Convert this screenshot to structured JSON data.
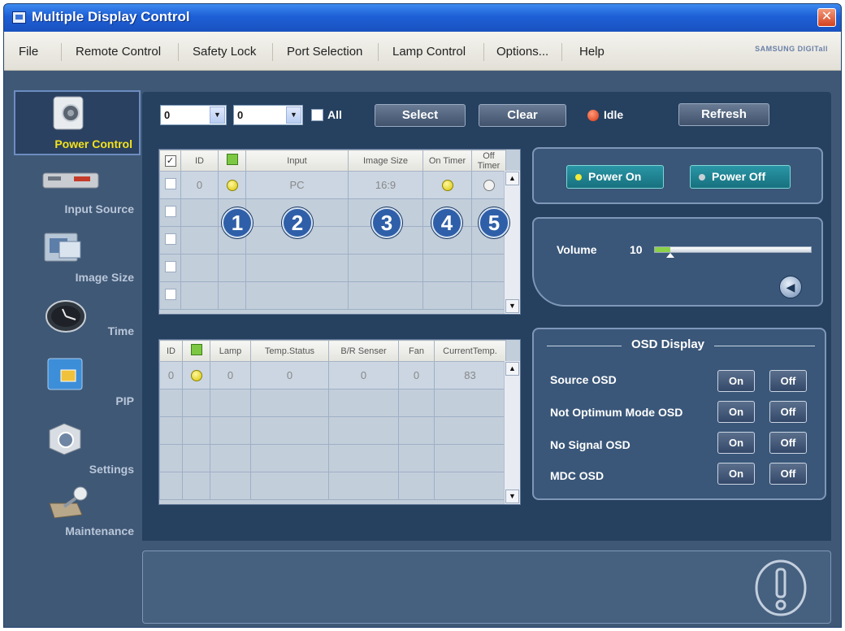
{
  "window": {
    "title": "Multiple Display Control",
    "close_glyph": "✕"
  },
  "menu": {
    "items": [
      "File",
      "Remote Control",
      "Safety Lock",
      "Port Selection",
      "Lamp Control",
      "Options...",
      "Help"
    ],
    "brand": "SAMSUNG DIGITall"
  },
  "nav": [
    {
      "label": "Power Control",
      "icon": "power-control-icon",
      "active": true
    },
    {
      "label": "Input Source",
      "icon": "input-source-icon"
    },
    {
      "label": "Image Size",
      "icon": "image-size-icon"
    },
    {
      "label": "Time",
      "icon": "clock-icon"
    },
    {
      "label": "PIP",
      "icon": "pip-icon"
    },
    {
      "label": "Settings",
      "icon": "settings-icon"
    },
    {
      "label": "Maintenance",
      "icon": "maintenance-icon"
    }
  ],
  "toolbar": {
    "select1_value": "0",
    "select2_value": "0",
    "all_label": "All",
    "select_label": "Select",
    "clear_label": "Clear",
    "status_label": "Idle",
    "refresh_label": "Refresh"
  },
  "top_grid": {
    "headers": [
      "ID",
      "Input",
      "Image Size",
      "On Timer",
      "Off Timer"
    ],
    "row": {
      "id": "0",
      "input": "PC",
      "image_size": "16:9"
    }
  },
  "callouts": [
    "1",
    "2",
    "3",
    "4",
    "5"
  ],
  "bottom_grid": {
    "headers": [
      "ID",
      "Lamp",
      "Temp.Status",
      "B/R Senser",
      "Fan",
      "CurrentTemp."
    ],
    "row": {
      "id": "0",
      "lamp": "0",
      "temp_status": "0",
      "br_senser": "0",
      "fan": "0",
      "current_temp": "83"
    }
  },
  "power": {
    "on_label": "Power On",
    "off_label": "Power Off"
  },
  "volume": {
    "label": "Volume",
    "value": "10",
    "level": 0.1
  },
  "osd": {
    "title": "OSD Display",
    "rows": [
      {
        "label": "Source OSD",
        "on": "On",
        "off": "Off"
      },
      {
        "label": "Not Optimum Mode OSD",
        "on": "On",
        "off": "Off"
      },
      {
        "label": "No Signal OSD",
        "on": "On",
        "off": "Off"
      },
      {
        "label": "MDC OSD",
        "on": "On",
        "off": "Off"
      }
    ]
  },
  "colors": {
    "accent": "#f3e21c",
    "window_bg": "#3f5876",
    "panel_bg": "#26405f",
    "power_btn": "#1f7f8f"
  }
}
